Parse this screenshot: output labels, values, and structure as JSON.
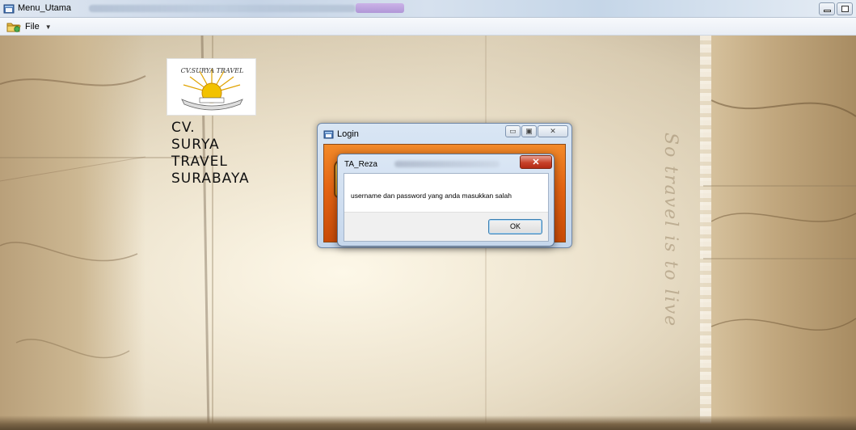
{
  "window": {
    "title": "Menu_Utama"
  },
  "menu": {
    "file_label": "File"
  },
  "company": {
    "logo_text": "CV.SURYA TRAVEL",
    "lines": [
      "CV.",
      "SURYA",
      "TRAVEL",
      "SURABAYA"
    ]
  },
  "background": {
    "script_text": "So travel is to live"
  },
  "login_window": {
    "title": "Login",
    "min_glyph": "▭",
    "max_glyph": "▣",
    "close_glyph": "✕"
  },
  "message_box": {
    "title": "TA_Reza",
    "close_glyph": "✕",
    "message": "username dan password yang anda masukkan salah",
    "ok_label": "OK"
  },
  "colors": {
    "accent_orange": "#e46413",
    "close_red": "#c7412a",
    "window_frame": "#c6d7ec"
  }
}
